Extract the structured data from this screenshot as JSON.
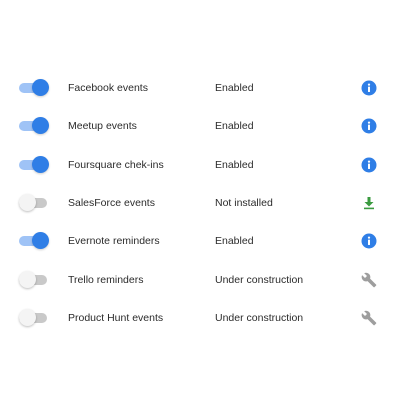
{
  "colors": {
    "accent": "#2f7ee6",
    "accent_track": "#9fc3f6",
    "off_track": "#c9c9c9",
    "install_green": "#3a9a3f",
    "wrench_gray": "#9e9e9e"
  },
  "integrations": [
    {
      "name": "Facebook events",
      "status": "Enabled",
      "enabled": true,
      "action_icon": "info-icon"
    },
    {
      "name": "Meetup events",
      "status": "Enabled",
      "enabled": true,
      "action_icon": "info-icon"
    },
    {
      "name": "Foursquare chek-ins",
      "status": "Enabled",
      "enabled": true,
      "action_icon": "info-icon"
    },
    {
      "name": "SalesForce events",
      "status": "Not installed",
      "enabled": false,
      "action_icon": "download-icon"
    },
    {
      "name": "Evernote reminders",
      "status": "Enabled",
      "enabled": true,
      "action_icon": "info-icon"
    },
    {
      "name": "Trello reminders",
      "status": "Under construction",
      "enabled": false,
      "action_icon": "wrench-icon"
    },
    {
      "name": "Product Hunt events",
      "status": "Under construction",
      "enabled": false,
      "action_icon": "wrench-icon"
    }
  ]
}
